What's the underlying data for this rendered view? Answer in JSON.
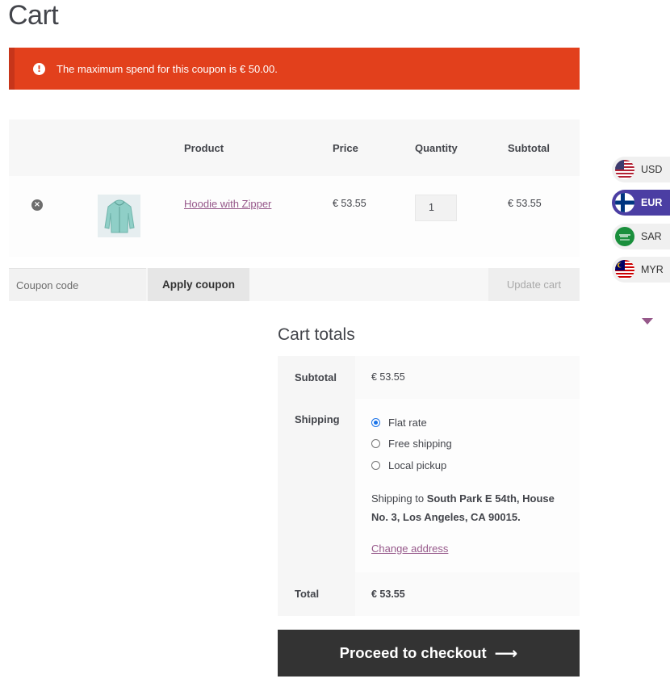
{
  "page": {
    "title": "Cart"
  },
  "notice": {
    "icon": "exclamation-icon",
    "message": "The maximum spend for this coupon is € 50.00."
  },
  "cart_table": {
    "headers": {
      "product": "Product",
      "price": "Price",
      "quantity": "Quantity",
      "subtotal": "Subtotal"
    },
    "rows": [
      {
        "product": "Hoodie with Zipper",
        "price": "€ 53.55",
        "quantity": "1",
        "subtotal": "€ 53.55"
      }
    ]
  },
  "actions": {
    "coupon_placeholder": "Coupon code",
    "apply_label": "Apply coupon",
    "update_label": "Update cart"
  },
  "totals": {
    "title": "Cart totals",
    "subtotal_label": "Subtotal",
    "subtotal_value": "€ 53.55",
    "shipping_label": "Shipping",
    "shipping_options": [
      "Flat rate",
      "Free shipping",
      "Local pickup"
    ],
    "selected_shipping": "Flat rate",
    "shipping_to_prefix": "Shipping to",
    "shipping_address": "South Park E 54th, House No. 3, Los Angeles, CA 90015.",
    "change_address": "Change address",
    "total_label": "Total",
    "total_value": "€ 53.55"
  },
  "checkout": {
    "label": "Proceed to checkout",
    "icon": "arrow-right-icon"
  },
  "currency_switcher": {
    "items": [
      {
        "code": "USD",
        "icon": "us-flag-icon"
      },
      {
        "code": "EUR",
        "icon": "finland-flag-icon"
      },
      {
        "code": "SAR",
        "icon": "saudi-flag-icon"
      },
      {
        "code": "MYR",
        "icon": "malaysia-flag-icon"
      }
    ],
    "active": "EUR",
    "colors": {
      "active_bg": "#4b3ea3",
      "caret": "#96588a"
    }
  },
  "colors": {
    "error_bg": "#e2401c",
    "link": "#96588a",
    "checkout_bg": "#333333"
  }
}
